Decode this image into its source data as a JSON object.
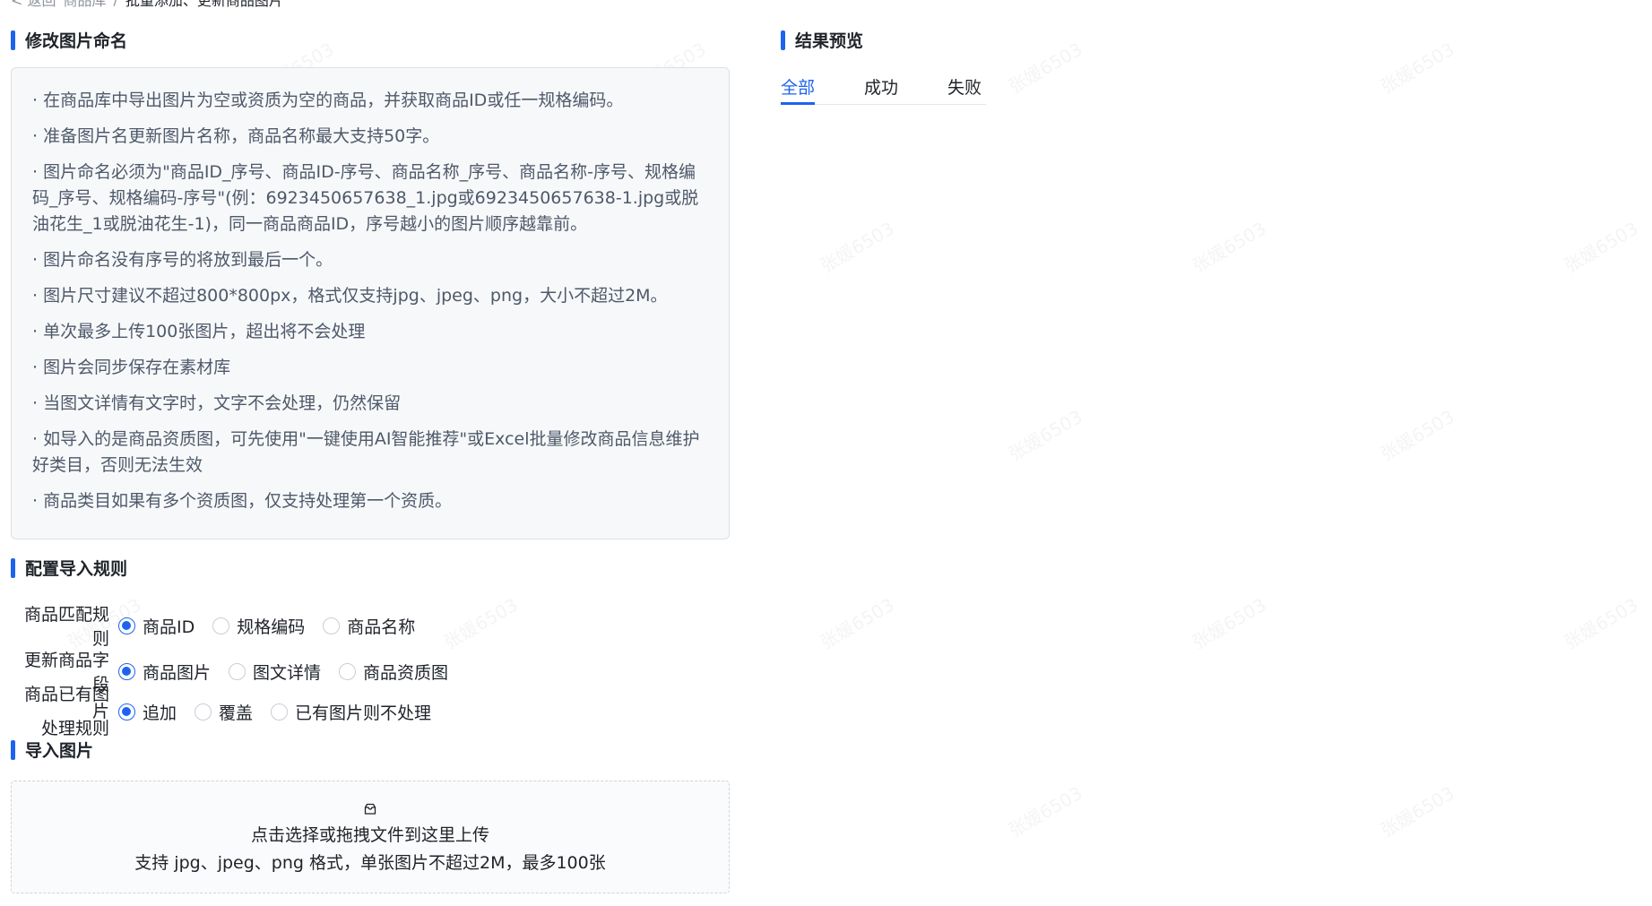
{
  "breadcrumb": {
    "back": "< 返回",
    "parent": "商品库",
    "separator": "/",
    "current": "批量添加、更新商品图片"
  },
  "rename_section": {
    "title": "修改图片命名",
    "rules": [
      "· 在商品库中导出图片为空或资质为空的商品，并获取商品ID或任一规格编码。",
      "· 准备图片名更新图片名称，商品名称最大支持50字。",
      "· 图片命名必须为\"商品ID_序号、商品ID-序号、商品名称_序号、商品名称-序号、规格编码_序号、规格编码-序号\"(例：6923450657638_1.jpg或6923450657638-1.jpg或脱油花生_1或脱油花生-1)，同一商品商品ID，序号越小的图片顺序越靠前。",
      "· 图片命名没有序号的将放到最后一个。",
      "· 图片尺寸建议不超过800*800px，格式仅支持jpg、jpeg、png，大小不超过2M。",
      "· 单次最多上传100张图片，超出将不会处理",
      "· 图片会同步保存在素材库",
      "· 当图文详情有文字时，文字不会处理，仍然保留",
      "· 如导入的是商品资质图，可先使用\"一键使用AI智能推荐\"或Excel批量修改商品信息维护好类目，否则无法生效",
      "· 商品类目如果有多个资质图，仅支持处理第一个资质。"
    ]
  },
  "config_section": {
    "title": "配置导入规则",
    "match_rule": {
      "label": "商品匹配规则",
      "options": [
        "商品ID",
        "规格编码",
        "商品名称"
      ],
      "selected": "商品ID"
    },
    "update_field": {
      "label": "更新商品字段",
      "options": [
        "商品图片",
        "图文详情",
        "商品资质图"
      ],
      "selected": "商品图片"
    },
    "existing_rule": {
      "label_line1": "商品已有图片",
      "label_line2": "处理规则",
      "options": [
        "追加",
        "覆盖",
        "已有图片则不处理"
      ],
      "selected": "追加"
    }
  },
  "import_section": {
    "title": "导入图片",
    "upload_icon": "upload-box-icon",
    "upload_text": "点击选择或拖拽文件到这里上传",
    "upload_hint": "支持 jpg、jpeg、png 格式，单张图片不超过2M，最多100张"
  },
  "preview_section": {
    "title": "结果预览",
    "tabs": [
      "全部",
      "成功",
      "失败"
    ],
    "active_tab": "全部"
  },
  "watermark": "张媛6503",
  "colors": {
    "accent": "#1e63f0",
    "text": "#1f2329",
    "muted": "#4e5969",
    "box_bg": "#f7f8fa"
  }
}
